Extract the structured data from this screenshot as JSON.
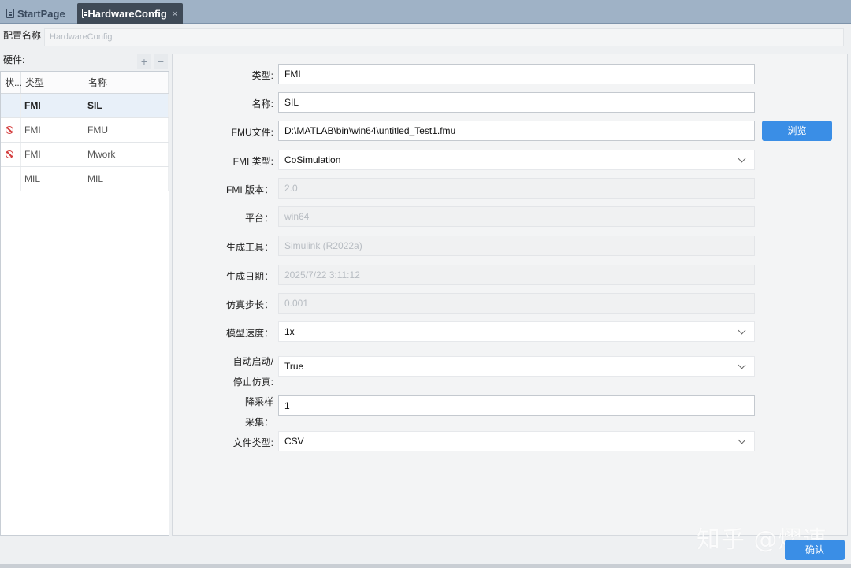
{
  "tabs": [
    {
      "label": "StartPage"
    },
    {
      "label": "HardwareConfig"
    }
  ],
  "config": {
    "label": "配置名称",
    "placeholder": "HardwareConfig"
  },
  "hardware": {
    "label": "硬件:",
    "add": "+",
    "remove": "−",
    "columns": [
      "状...",
      "类型",
      "名称"
    ],
    "rows": [
      {
        "status": "",
        "type": "FMI",
        "name": "SIL"
      },
      {
        "status": "disabled",
        "type": "FMI",
        "name": "FMU"
      },
      {
        "status": "disabled",
        "type": "FMI",
        "name": "Mwork"
      },
      {
        "status": "",
        "type": "MIL",
        "name": "MIL"
      }
    ]
  },
  "form": {
    "type_label": "类型:",
    "type_value": "FMI",
    "name_label": "名称:",
    "name_value": "SIL",
    "fmu_label": "FMU文件:",
    "fmu_value": "D:\\MATLAB\\bin\\win64\\untitled_Test1.fmu",
    "browse": "浏览",
    "fmi_type_label": "FMI 类型:",
    "fmi_type_value": "CoSimulation",
    "fmi_version_label": "FMI 版本：",
    "fmi_version_value": "2.0",
    "platform_label": "平台：",
    "platform_value": "win64",
    "tool_label": "生成工具：",
    "tool_value": "Simulink (R2022a)",
    "date_label": "生成日期：",
    "date_value": "2025/7/22 3:11:12",
    "step_label": "仿真步长：",
    "step_value": "0.001",
    "speed_label": "模型速度：",
    "speed_value": "1x",
    "auto_label_1": "自动启动/",
    "auto_label_2": "停止仿真:",
    "auto_value": "True",
    "downsample_label_1": "降采样",
    "downsample_label_2": "采集：",
    "downsample_value": "1",
    "filetype_label": "文件类型:",
    "filetype_value": "CSV"
  },
  "confirm": "确认",
  "watermark": "知乎 @熠速"
}
